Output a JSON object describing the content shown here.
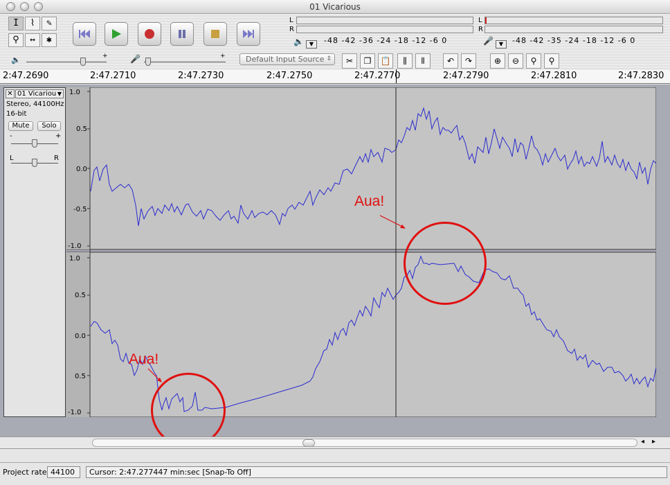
{
  "window": {
    "title": "01 Vicarious"
  },
  "meters": {
    "output_labels": [
      "L",
      "R"
    ],
    "input_labels": [
      "L",
      "R"
    ],
    "output_scale": "-48 -42 -36    -24 -18 -12  -6   0",
    "input_scale": "-48 -42 -35    -24 -18 -12  -6   0"
  },
  "input_source": {
    "value": "Default Input Source"
  },
  "ruler": {
    "labels": [
      "2:47.2690",
      "2:47.2710",
      "2:47.2730",
      "2:47.2750",
      "2:47.2770",
      "2:47.2790",
      "2:47.2810",
      "2:47.2830"
    ]
  },
  "track": {
    "name": "01 Vicariou",
    "format": "Stereo, 44100Hz",
    "bits": "16-bit",
    "mute_label": "Mute",
    "solo_label": "Solo",
    "pan_left": "L",
    "pan_right": "R",
    "gain_minus": "-",
    "gain_plus": "+",
    "upper_scale": [
      "1.0",
      "0.5",
      "0.0",
      "-0.5",
      "-1.0"
    ],
    "lower_scale": [
      "1.0",
      "0.5",
      "0.0",
      "0.5",
      "-1.0"
    ]
  },
  "annotations": [
    {
      "text": "Aua!"
    },
    {
      "text": "Aua!"
    }
  ],
  "status": {
    "project_rate_label": "Project rate:",
    "project_rate_value": "44100",
    "cursor_text": "Cursor: 2:47.277447 min:sec  [Snap-To Off]"
  },
  "colors": {
    "waveform": "#2b2bd0",
    "annotation": "#e01010",
    "track_bg": "#c4c4c4"
  }
}
